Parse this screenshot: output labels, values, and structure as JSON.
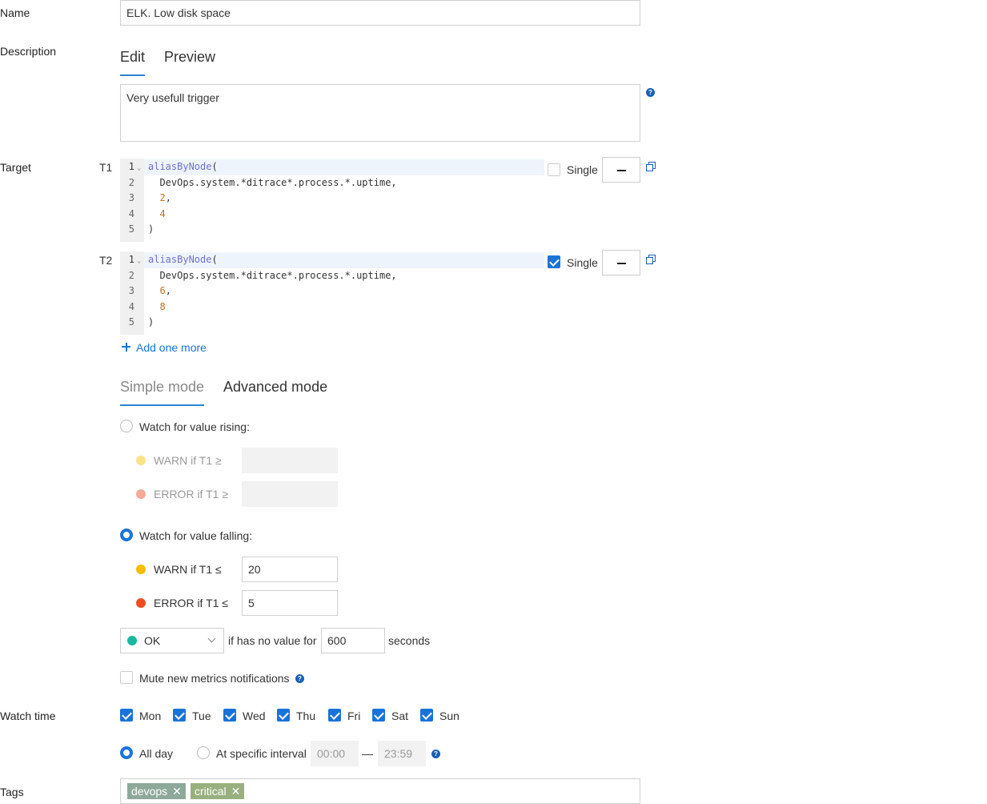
{
  "name": {
    "label": "Name",
    "value": "ELK. Low disk space"
  },
  "description": {
    "label": "Description",
    "tabs": [
      "Edit",
      "Preview"
    ],
    "value": "Very usefull trigger",
    "help": "?"
  },
  "target": {
    "label": "Target",
    "single_label": "Single",
    "items": [
      {
        "id": "T1",
        "single": false,
        "lines": [
          "1",
          "2",
          "3",
          "4",
          "5"
        ],
        "code": {
          "l1_fn": "aliasByNode",
          "l1_rest": "(",
          "l2": "  DevOps.system.*ditrace*.process.*.uptime,",
          "l3_num": "2",
          "l3_rest": ",",
          "l4_num": "4",
          "l5": ")"
        }
      },
      {
        "id": "T2",
        "single": true,
        "lines": [
          "1",
          "2",
          "3",
          "4",
          "5"
        ],
        "code": {
          "l1_fn": "aliasByNode",
          "l1_rest": "(",
          "l2": "  DevOps.system.*ditrace*.process.*.uptime,",
          "l3_num": "6",
          "l3_rest": ",",
          "l4_num": "8",
          "l5": ")"
        }
      }
    ],
    "add_more": "Add one more"
  },
  "mode": {
    "tabs": [
      "Simple mode",
      "Advanced mode"
    ],
    "rising": {
      "label": "Watch for value rising:",
      "warn": "WARN if T1 ≥",
      "error": "ERROR if T1 ≥",
      "warn_value": "",
      "error_value": ""
    },
    "falling": {
      "label": "Watch for value falling:",
      "warn": "WARN if T1 ≤",
      "error": "ERROR if T1 ≤",
      "warn_value": "20",
      "error_value": "5"
    },
    "no_value": {
      "state": "OK",
      "text": "if has no value for",
      "seconds": "600",
      "unit": "seconds"
    },
    "mute": "Mute new metrics notifications"
  },
  "watch_time": {
    "label": "Watch time",
    "days": [
      "Mon",
      "Tue",
      "Wed",
      "Thu",
      "Fri",
      "Sat",
      "Sun"
    ],
    "all_day": "All day",
    "specific": "At specific interval",
    "from": "00:00",
    "dash": "—",
    "to": "23:59"
  },
  "tags": {
    "label": "Tags",
    "items": [
      "devops",
      "critical"
    ],
    "remove": "✕"
  },
  "colors": {
    "accent": "#1a73d9",
    "warn": "#f5bc00",
    "error": "#f04c24",
    "warn_dim": "#f9e28a",
    "error_dim": "#f4ab98",
    "ok": "#1bb8a0",
    "tag_devops": "#8ea89a",
    "tag_critical": "#98b080"
  }
}
